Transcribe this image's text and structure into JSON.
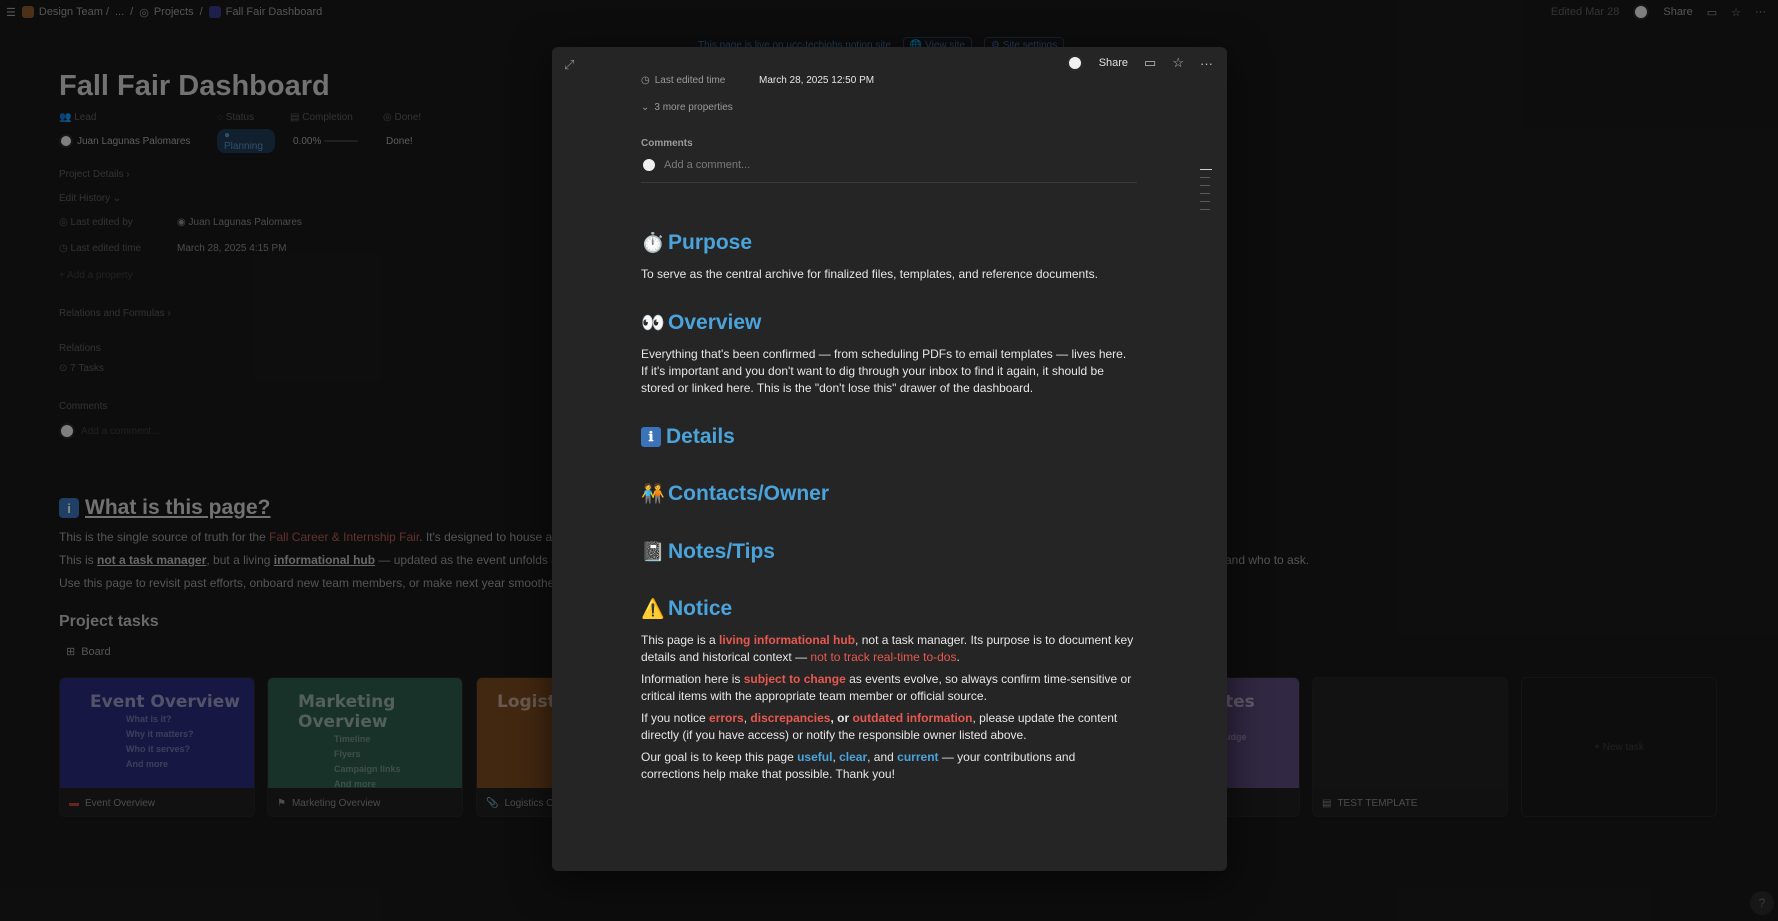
{
  "topbar": {
    "crumbs": [
      "Design Team /",
      "...",
      "/",
      "Projects",
      "/",
      "Fall Fair Dashboard"
    ],
    "edited": "Edited Mar 28",
    "share": "Share"
  },
  "banner": {
    "text": "This page is live on ucc-techjobs.notion.site",
    "view_site": "View site",
    "site_settings": "Site settings"
  },
  "background": {
    "title": "Fall Fair Dashboard",
    "props": {
      "lead_label": "Lead",
      "status_label": "Status",
      "completion_label": "Completion",
      "done_label": "Done!",
      "lead_value": "Juan Lagunas Palomares",
      "status_value": "Planning",
      "completion_value": "0.00%",
      "done_value": "Done!"
    },
    "project_details": "Project Details",
    "edit_history": "Edit History",
    "last_edited_by_label": "Last edited by",
    "last_edited_by_value": "Juan Lagunas Palomares",
    "last_edited_time_label": "Last edited time",
    "last_edited_time_value": "March 28, 2025 4:15 PM",
    "add_property": "Add a property",
    "relations_formulas": "Relations and Formulas",
    "relations": "Relations",
    "tasks": "7 Tasks",
    "comments": "Comments",
    "add_comment": "Add a comment...",
    "what_heading": "What is this page?",
    "para1_a": "This is the single source of truth for the ",
    "para1_link": "Fall Career & Internship Fair",
    "para1_b": ". It's designed to house all key",
    "para2_a": "This is ",
    "para2_b1": "not a task manager",
    "para2_c": ", but a living ",
    "para2_b2": "informational hub",
    "para2_d": " — updated as the event unfolds and af",
    "para2_end": "and who to ask.",
    "para3": "Use this page to revisit past efforts, onboard new team members, or make next year smoother.",
    "project_tasks": "Project tasks",
    "board": "Board",
    "cards": [
      {
        "title": "Event Overview",
        "lines": [
          "What is it?",
          "Why it matters?",
          "Who it serves?",
          "And more"
        ],
        "footer": "Event Overview",
        "color": "#2a2a7a"
      },
      {
        "title": "Marketing Overview",
        "lines": [
          "Timeline",
          "Flyers",
          "Campaign links",
          "And more"
        ],
        "footer": "Marketing Overview",
        "color": "#2c5a4b"
      },
      {
        "title": "Logistics",
        "lines": [
          "",
          "",
          "",
          ""
        ],
        "footer": "Logistics O",
        "color": "#7a4a20"
      }
    ],
    "card_partial_title": "tes",
    "card_partial_line": "udge",
    "test_template": "TEST TEMPLATE",
    "new_task": "+ New task"
  },
  "modal": {
    "share": "Share",
    "last_edited_time_label": "Last edited time",
    "last_edited_time_value": "March 28, 2025 12:50 PM",
    "more_props": "3 more properties",
    "comments_label": "Comments",
    "add_comment": "Add a comment...",
    "purpose_h": "Purpose",
    "purpose_p": "To serve as the central archive for finalized files, templates, and reference documents.",
    "overview_h": "Overview",
    "overview_p": "Everything that's been confirmed — from scheduling PDFs to email templates — lives here. If it's important and you don't want to dig through your inbox to find it again, it should be stored or linked here. This is the \"don't lose this\" drawer of the dashboard.",
    "details_h": "Details",
    "contacts_h": "Contacts/Owner",
    "notes_h": "Notes/Tips",
    "notice_h": "Notice",
    "n1_a": "This page is a ",
    "n1_b": "living informational hub",
    "n1_c": ", not a task manager. Its purpose is to document key details and historical context — ",
    "n1_d": "not to track real-time to-dos",
    "n1_e": ".",
    "n2_a": "Information here is ",
    "n2_b": "subject to change",
    "n2_c": " as events evolve, so always confirm time-sensitive or critical items with the appropriate team member or official source.",
    "n3_a": "If you notice ",
    "n3_b": "errors",
    "n3_c": ", ",
    "n3_d": "discrepancies",
    "n3_e": ", or ",
    "n3_f": "outdated information",
    "n3_g": ", please update the content directly (if you have access) or notify the responsible owner listed above.",
    "n4_a": "Our goal is to keep this page ",
    "n4_b": "useful",
    "n4_c": ", ",
    "n4_d": "clear",
    "n4_e": ", and ",
    "n4_f": "current",
    "n4_g": " — your contributions and corrections help make that possible. Thank you!"
  },
  "icons": {
    "purpose": "⏱️",
    "overview": "👀",
    "details": "ℹ",
    "contacts": "🧑‍🤝‍🧑",
    "notes": "📓",
    "notice": "⚠️"
  }
}
